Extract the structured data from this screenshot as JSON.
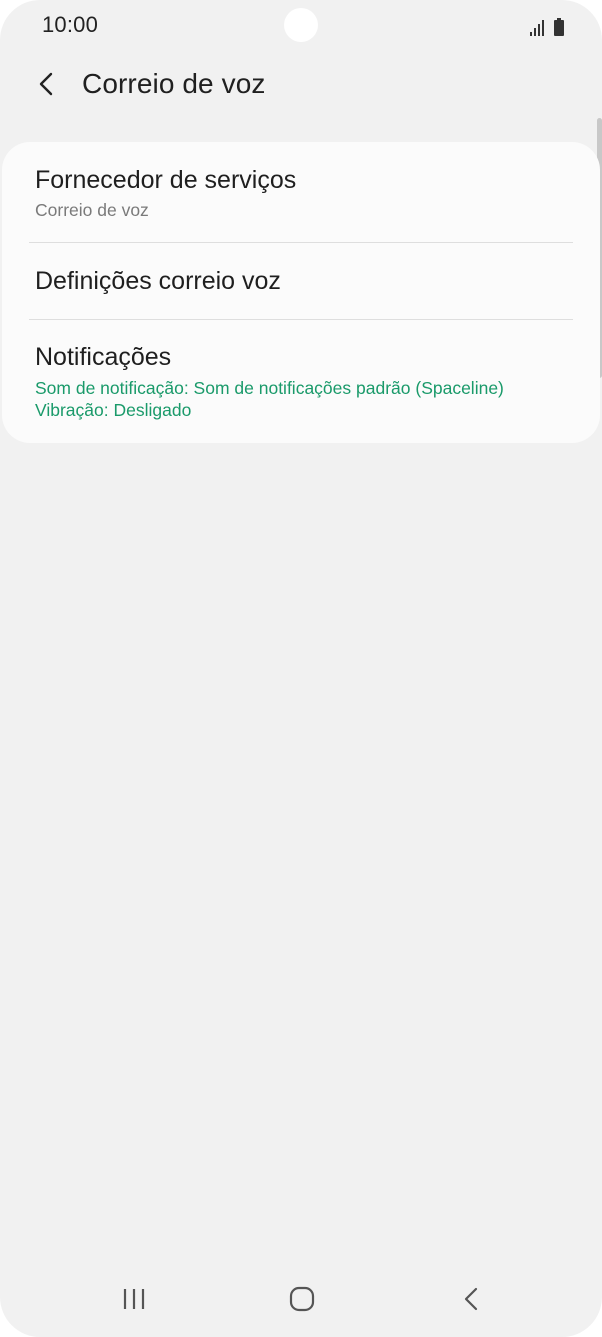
{
  "status_bar": {
    "time": "10:00",
    "icons": [
      "signal-icon",
      "battery-icon"
    ]
  },
  "app_bar": {
    "back_icon": "chevron-left-icon",
    "title": "Correio de voz"
  },
  "settings": {
    "items": [
      {
        "title": "Fornecedor de serviços",
        "subtitle": "Correio de voz"
      },
      {
        "title": "Definições correio voz"
      },
      {
        "title": "Notificações",
        "subtitle_line1": "Som de notificação: Som de notificações padrão (Spaceline)",
        "subtitle_line2": "Vibração: Desligado"
      }
    ]
  },
  "nav_bar": {
    "recents_icon": "recents-icon",
    "home_icon": "home-icon",
    "back_icon": "back-icon"
  },
  "colors": {
    "background": "#f1f1f1",
    "card": "#fbfbfb",
    "accent_green": "#1a9a6a",
    "text_primary": "#1f1f1f",
    "text_secondary": "#7a7a7a"
  }
}
